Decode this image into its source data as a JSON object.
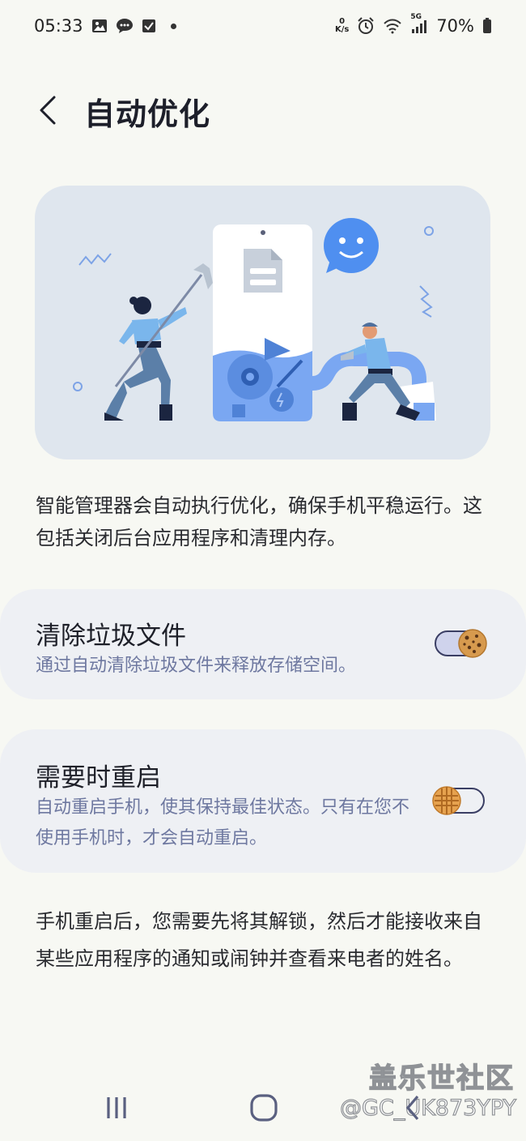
{
  "status_bar": {
    "time": "05:33",
    "speed_value": "0",
    "speed_unit": "K/s",
    "network": "5G",
    "battery": "70%",
    "icons": [
      "gallery-icon",
      "chat-icon",
      "check-icon",
      "alarm-icon",
      "wifi-icon",
      "signal-icon",
      "battery-icon"
    ]
  },
  "header": {
    "title": "自动优化"
  },
  "description": "智能管理器会自动执行优化，确保手机平稳运行。这包括关闭后台应用程序和清理内存。",
  "settings": [
    {
      "title": "清除垃圾文件",
      "subtitle": "通过自动清除垃圾文件来释放存储空间。",
      "enabled": true
    },
    {
      "title": "需要时重启",
      "subtitle": "自动重启手机，使其保持最佳状态。只有在您不使用手机时，才会自动重启。",
      "enabled": false
    }
  ],
  "note": "手机重启后，您需要先将其解锁，然后才能接收来自某些应用程序的通知或闹钟并查看来电者的姓名。",
  "watermark": {
    "brand": "盖乐世社区",
    "handle": "@GC_UK873YPY"
  },
  "colors": {
    "background": "#f7f8f3",
    "card": "#eef0f4",
    "subtitle": "#6e78a0",
    "accent": "#3a3e64",
    "hero": "#dfe6ee"
  }
}
